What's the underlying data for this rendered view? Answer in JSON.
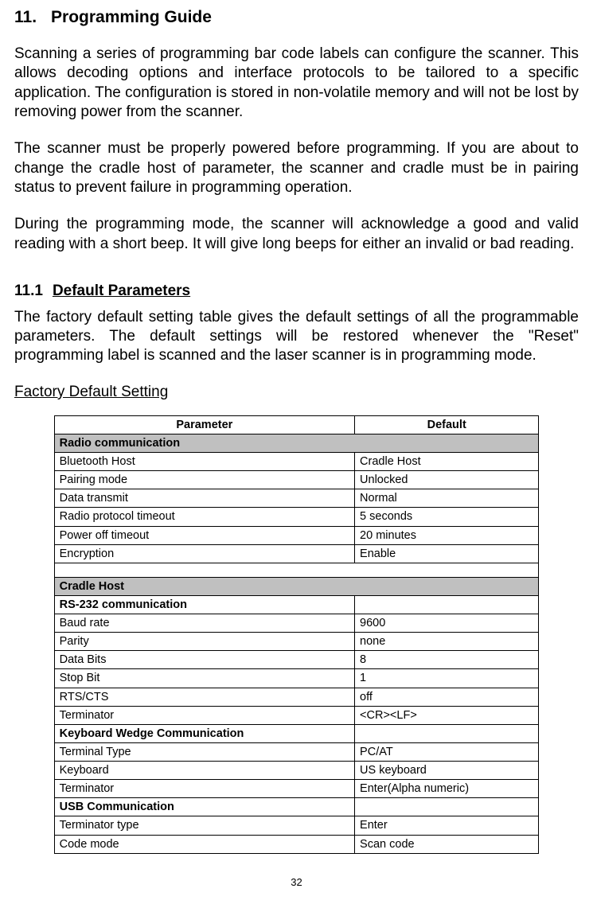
{
  "chapter": {
    "number": "11.",
    "title": "Programming Guide"
  },
  "paragraphs": {
    "p1": "Scanning a series of programming bar code labels can configure the scanner. This allows decoding options and interface protocols to be tailored to a specific application. The configuration is stored in non-volatile memory and will not be lost by removing power from the scanner.",
    "p2": "The scanner must be properly powered before programming.    If you are about to change the cradle host of parameter, the scanner and cradle must be in pairing status to prevent failure in programming operation.",
    "p3": "During the programming mode, the scanner will acknowledge a good and valid reading with a short beep. It will give long beeps for either an invalid or bad reading."
  },
  "section": {
    "number": "11.1",
    "title": "Default Parameters",
    "intro": "The factory default setting table gives the default settings of all the programmable parameters. The default settings will be restored whenever the \"Reset\" programming label is scanned and the laser scanner is in programming mode.",
    "subheading": "Factory Default Setting"
  },
  "table": {
    "headers": {
      "param": "Parameter",
      "default": "Default"
    },
    "group1": {
      "label": "Radio communication",
      "rows": [
        {
          "param": "Bluetooth Host",
          "default": "Cradle Host"
        },
        {
          "param": "Pairing mode",
          "default": "Unlocked"
        },
        {
          "param": "Data transmit",
          "default": "Normal"
        },
        {
          "param": "Radio protocol timeout",
          "default": "5 seconds"
        },
        {
          "param": "Power off timeout",
          "default": "20 minutes"
        },
        {
          "param": "Encryption",
          "default": "Enable"
        }
      ]
    },
    "group2": {
      "label": "Cradle Host",
      "sub1": {
        "label": "RS-232 communication",
        "rows": [
          {
            "param": "Baud rate",
            "default": "9600"
          },
          {
            "param": "Parity",
            "default": "none"
          },
          {
            "param": "Data Bits",
            "default": "8"
          },
          {
            "param": "Stop Bit",
            "default": "1"
          },
          {
            "param": "RTS/CTS",
            "default": "off"
          },
          {
            "param": "Terminator",
            "default": "<CR><LF>"
          }
        ]
      },
      "sub2": {
        "label": "Keyboard Wedge Communication",
        "rows": [
          {
            "param": "Terminal Type",
            "default": "PC/AT"
          },
          {
            "param": "Keyboard",
            "default": "US keyboard"
          },
          {
            "param": "Terminator",
            "default": "Enter(Alpha numeric)"
          }
        ]
      },
      "sub3": {
        "label": "USB Communication",
        "rows": [
          {
            "param": "Terminator type",
            "default": "Enter"
          },
          {
            "param": "Code mode",
            "default": "Scan code"
          }
        ]
      }
    }
  },
  "page_number": "32"
}
